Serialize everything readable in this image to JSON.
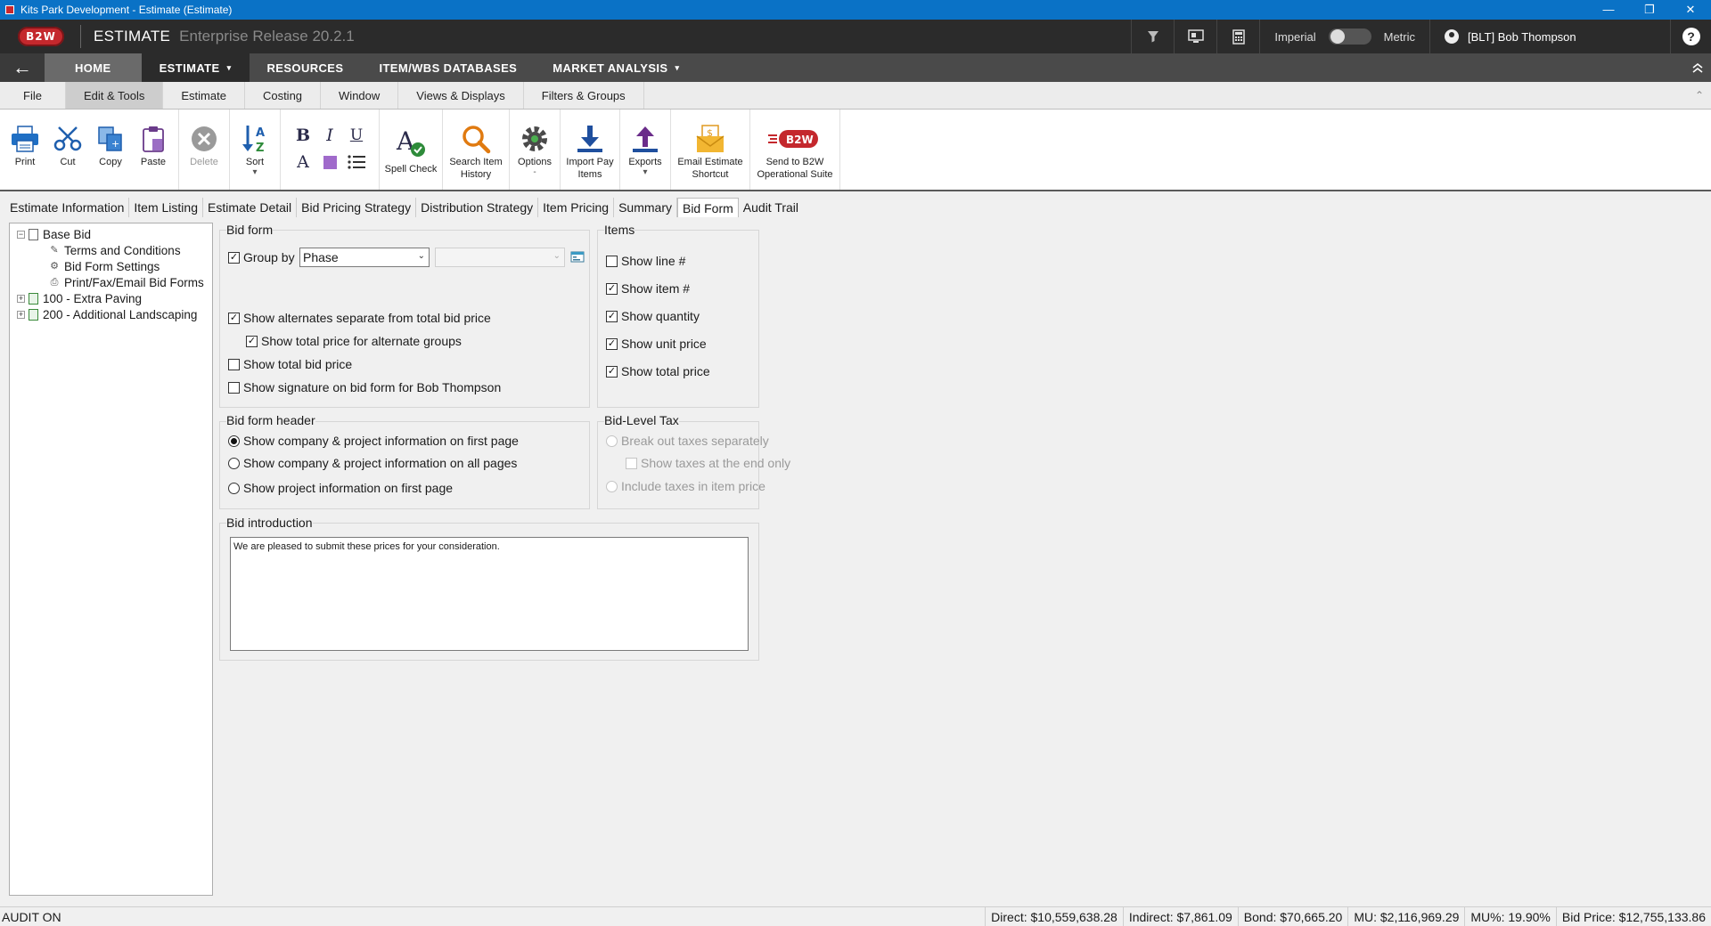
{
  "window": {
    "title": "Kits Park Development - Estimate (Estimate)",
    "controls": [
      "—",
      "❐",
      "✕"
    ]
  },
  "appbar": {
    "logo": "B2W",
    "title": "ESTIMATE",
    "release": "Enterprise Release 20.2.1",
    "unit_left": "Imperial",
    "unit_right": "Metric",
    "user": "[BLT] Bob Thompson",
    "help": "?"
  },
  "nav": {
    "back": "←",
    "home": "HOME",
    "estimate": "ESTIMATE",
    "resources": "RESOURCES",
    "databases": "ITEM/WBS DATABASES",
    "market": "MARKET ANALYSIS"
  },
  "ribbon_tabs": [
    "File",
    "Edit & Tools",
    "Estimate",
    "Costing",
    "Window",
    "Views & Displays",
    "Filters & Groups"
  ],
  "ribbon": {
    "print": "Print",
    "cut": "Cut",
    "copy": "Copy",
    "paste": "Paste",
    "delete": "Delete",
    "sort": "Sort",
    "spell": "Spell Check",
    "search_history": "Search Item History",
    "options": "Options",
    "import_pay": "Import Pay Items",
    "exports": "Exports",
    "email": "Email Estimate Shortcut",
    "send": "Send to B2W Operational Suite",
    "dash": "-"
  },
  "content_tabs": [
    "Estimate Information",
    "Item Listing",
    "Estimate Detail",
    "Bid Pricing Strategy",
    "Distribution Strategy",
    "Item Pricing",
    "Summary",
    "Bid Form",
    "Audit Trail"
  ],
  "tree": {
    "root": "Base Bid",
    "children": [
      "Terms and Conditions",
      "Bid Form Settings",
      "Print/Fax/Email Bid Forms"
    ],
    "alt1": "100 - Extra Paving",
    "alt2": "200 - Additional Landscaping"
  },
  "bid_form": {
    "title": "Bid form",
    "group_by_label": "Group by",
    "group_by_value": "Phase",
    "group_by_checked": true,
    "show_alternates": "Show alternates separate from total bid price",
    "show_total_alt": "Show total price for alternate groups",
    "show_total_bid": "Show total bid price",
    "show_signature": "Show signature on bid form for Bob Thompson"
  },
  "items": {
    "title": "Items",
    "line": "Show line #",
    "item": "Show item #",
    "quantity": "Show quantity",
    "unit_price": "Show unit price",
    "total_price": "Show total price"
  },
  "header": {
    "title": "Bid form header",
    "opt1": "Show company & project information on first page",
    "opt2": "Show company & project information on all pages",
    "opt3": "Show project information on first page"
  },
  "tax": {
    "title": "Bid-Level Tax",
    "breakout": "Break out taxes separately",
    "end_only": "Show taxes at the end only",
    "include": "Include taxes in item price"
  },
  "intro": {
    "title": "Bid introduction",
    "text": "We are pleased to submit these prices for your consideration."
  },
  "status": {
    "audit": "AUDIT ON",
    "direct": "Direct:  $10,559,638.28",
    "indirect": "Indirect:  $7,861.09",
    "bond": "Bond:  $70,665.20",
    "mu": "MU:  $2,116,969.29",
    "mu_pct": "MU%:  19.90%",
    "bid_price": "Bid Price:  $12,755,133.86"
  },
  "glyphs": {
    "check": "✓",
    "plus": "+",
    "minus": "−",
    "dd": "⌄",
    "caret": "▾",
    "collapse": "⌃"
  },
  "colors": {
    "titlebar": "#0a72c6",
    "brand_red": "#c4282d",
    "appbar": "#2b2b2b"
  }
}
